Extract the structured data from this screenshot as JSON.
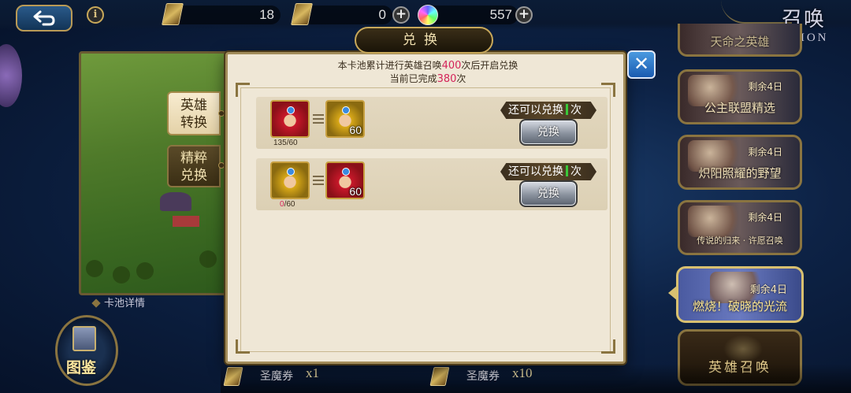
{
  "topbar": {
    "resource1_value": "18",
    "resource2_value": "0",
    "gem_value": "557",
    "summon_title": "召唤",
    "summon_subtitle": "SUMMON"
  },
  "left_panel": {
    "tabs": [
      {
        "label_line1": "英雄",
        "label_line2": "转换",
        "active": true
      },
      {
        "label_line1": "精粹",
        "label_line2": "兑换",
        "active": false
      }
    ],
    "pool_details_label": "卡池详情",
    "codex_label": "图鉴"
  },
  "modal": {
    "title": "兑换",
    "notice_prefix": "本卡池累计进行英雄召唤",
    "notice_count": "400",
    "notice_suffix": "次后开启兑换",
    "progress_prefix": "当前已完成",
    "progress_count": "380",
    "progress_suffix": "次",
    "rows": [
      {
        "source_hero": "red-hero",
        "source_progress_have": "135",
        "source_progress_sep": "/60",
        "target_hero": "gold-hero",
        "target_count": "60",
        "remaining_prefix": "还可以兑换",
        "remaining_suffix": "次",
        "button_label": "兑换"
      },
      {
        "source_hero": "gold-hero",
        "source_progress_have": "0",
        "source_progress_sep": "/60",
        "target_hero": "red-hero",
        "target_count": "60",
        "remaining_prefix": "还可以兑换",
        "remaining_suffix": "次",
        "button_label": "兑换"
      }
    ],
    "close_icon": "close-icon"
  },
  "right_pools": {
    "top_partial_title": "天命之英雄",
    "cards": [
      {
        "badge": "剩余4日",
        "title": "公主联盟精选"
      },
      {
        "badge": "剩余4日",
        "title": "炽阳照耀的野望"
      },
      {
        "badge": "剩余4日",
        "title": "传说的归来 · 许愿召唤"
      },
      {
        "badge": "剩余4日",
        "title": "燃烧！破晓的光流"
      }
    ],
    "hero_summon_label": "英雄召唤"
  },
  "bottom": {
    "cost1_label": "圣魔券",
    "cost1_qty": "x1",
    "cost2_label": "圣魔券",
    "cost2_qty": "x10"
  },
  "colors": {
    "accent_red": "#d4245a",
    "gold_border": "#a28c5a",
    "parchment": "#efe7d6",
    "remain_bar_green": "#3ac83a"
  }
}
